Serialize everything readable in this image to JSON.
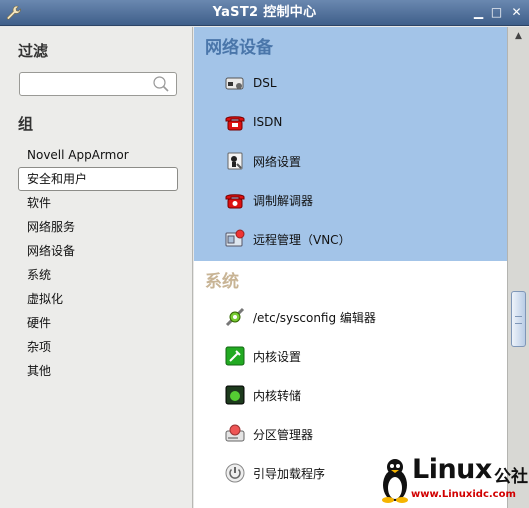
{
  "window": {
    "title": "YaST2 控制中心",
    "buttons": {
      "minimize": "▁",
      "maximize": "□",
      "close": "✕"
    }
  },
  "sidebar": {
    "filter_heading": "过滤",
    "search": {
      "value": "",
      "placeholder": ""
    },
    "group_heading": "组",
    "items": [
      {
        "label": "Novell AppArmor",
        "selected": false
      },
      {
        "label": "安全和用户",
        "selected": true
      },
      {
        "label": "软件",
        "selected": false
      },
      {
        "label": "网络服务",
        "selected": false
      },
      {
        "label": "网络设备",
        "selected": false
      },
      {
        "label": "系统",
        "selected": false
      },
      {
        "label": "虚拟化",
        "selected": false
      },
      {
        "label": "硬件",
        "selected": false
      },
      {
        "label": "杂项",
        "selected": false
      },
      {
        "label": "其他",
        "selected": false
      }
    ]
  },
  "sections": {
    "network_devices": {
      "title": "网络设备",
      "items": [
        {
          "label": "DSL",
          "icon": "dsl-modem-icon"
        },
        {
          "label": "ISDN",
          "icon": "isdn-phone-icon"
        },
        {
          "label": "网络设置",
          "icon": "network-settings-icon"
        },
        {
          "label": "调制解调器",
          "icon": "modem-phone-icon"
        },
        {
          "label": "远程管理（VNC）",
          "icon": "remote-admin-icon"
        }
      ]
    },
    "system": {
      "title": "系统",
      "items": [
        {
          "label": "/etc/sysconfig 编辑器",
          "icon": "sysconfig-editor-icon"
        },
        {
          "label": "内核设置",
          "icon": "kernel-settings-icon"
        },
        {
          "label": "内核转储",
          "icon": "kernel-dump-icon"
        },
        {
          "label": "分区管理器",
          "icon": "partitioner-icon"
        },
        {
          "label": "引导加载程序",
          "icon": "bootloader-icon"
        }
      ]
    }
  },
  "watermark": {
    "brand": "Linux",
    "brand_cn": "公社",
    "url": "www.Linuxidc.com"
  },
  "colors": {
    "titlebar": "#4f6f9c",
    "network_section_bg": "#a3c4e8",
    "network_title": "#4a76aa",
    "system_title": "#c8b495"
  }
}
